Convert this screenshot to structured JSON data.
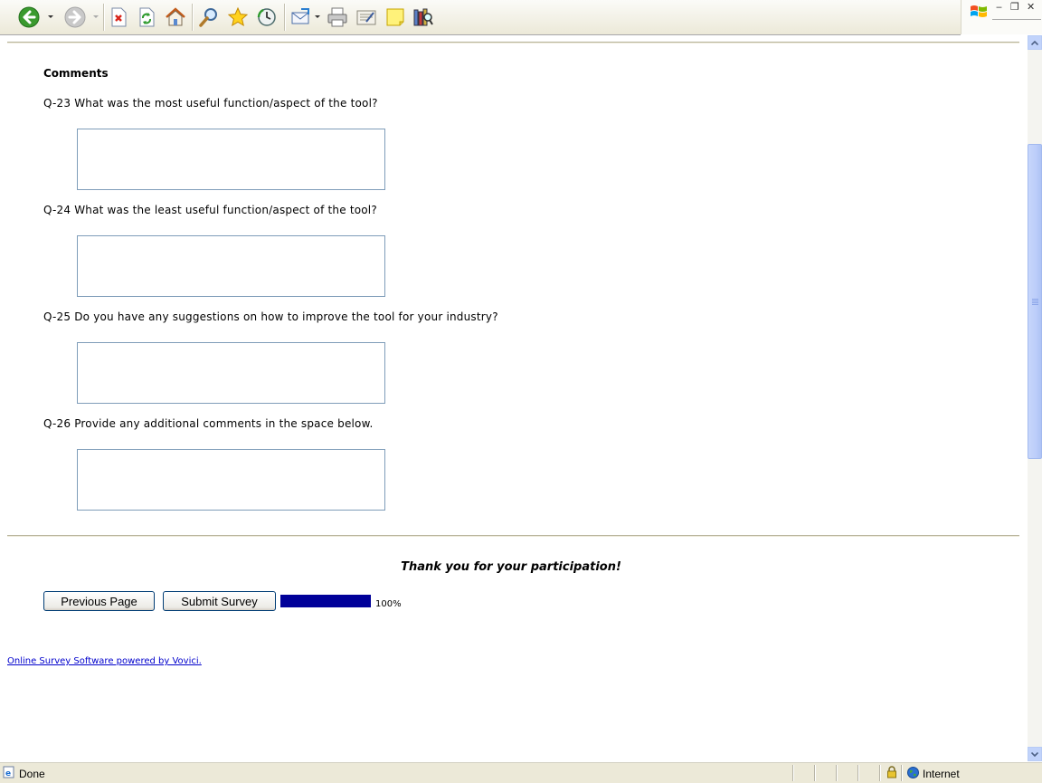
{
  "toolbar": {
    "buttons": [
      "back-icon",
      "forward-icon",
      "stop-icon",
      "refresh-icon",
      "home-icon",
      "search-icon",
      "favorites-icon",
      "history-icon",
      "mail-icon",
      "print-icon",
      "edit-icon",
      "discuss-icon",
      "research-icon"
    ]
  },
  "window": {
    "minimize": "‒",
    "restore": "❐",
    "close": "✕"
  },
  "survey": {
    "heading": "Comments",
    "questions": [
      {
        "label": "Q-23 What was the most useful function/aspect of the tool?",
        "value": ""
      },
      {
        "label": "Q-24 What was the least useful function/aspect of the tool?",
        "value": ""
      },
      {
        "label": "Q-25 Do you have any suggestions on how to improve the tool for your industry?",
        "value": ""
      },
      {
        "label": "Q-26 Provide any additional comments in the space below.",
        "value": ""
      }
    ],
    "thanks": "Thank you for your participation!",
    "previous_label": "Previous Page",
    "submit_label": "Submit Survey",
    "progress": 100,
    "progress_text": "100%",
    "progress_color": "#000099",
    "footer_link": "Online Survey Software powered by Vovici."
  },
  "status": {
    "text": "Done",
    "zone": "Internet"
  }
}
